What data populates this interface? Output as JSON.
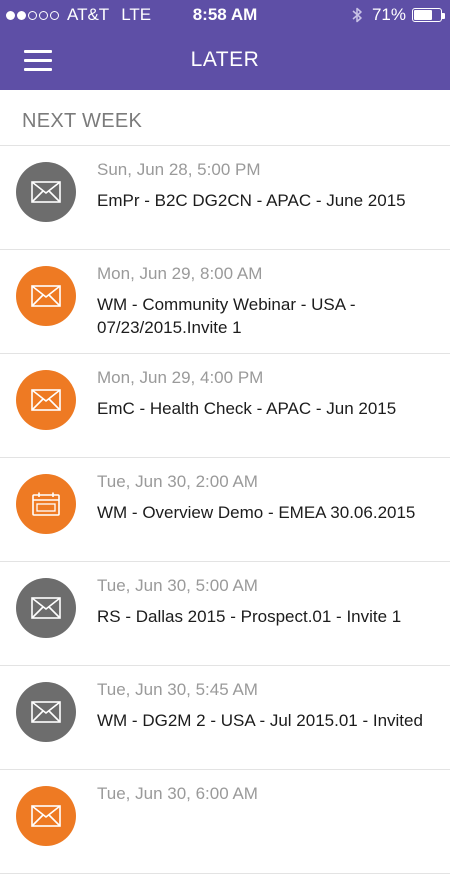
{
  "status_bar": {
    "carrier": "AT&T",
    "network": "LTE",
    "time": "8:58 AM",
    "battery": "71%",
    "battery_level": 0.71,
    "signal_bars": 2
  },
  "nav": {
    "title": "LATER"
  },
  "section": {
    "title": "NEXT WEEK"
  },
  "colors": {
    "header": "#5e4fa6",
    "orange": "#ee7a23",
    "gray": "#6d6d6d"
  },
  "items": [
    {
      "date": "Sun, Jun 28, 5:00 PM",
      "subject": "EmPr - B2C DG2CN - APAC - June 2015",
      "icon": "mail-icon",
      "color": "gray"
    },
    {
      "date": "Mon, Jun 29, 8:00 AM",
      "subject": "WM - Community Webinar - USA - 07/23/2015.Invite 1",
      "icon": "mail-icon",
      "color": "orange"
    },
    {
      "date": "Mon, Jun 29, 4:00 PM",
      "subject": "EmC - Health Check - APAC - Jun 2015",
      "icon": "mail-icon",
      "color": "orange"
    },
    {
      "date": "Tue, Jun 30, 2:00 AM",
      "subject": "WM - Overview Demo - EMEA 30.06.2015",
      "icon": "calendar-icon",
      "color": "orange"
    },
    {
      "date": "Tue, Jun 30, 5:00 AM",
      "subject": "RS - Dallas 2015 - Prospect.01 - Invite 1",
      "icon": "mail-icon",
      "color": "gray"
    },
    {
      "date": "Tue, Jun 30, 5:45 AM",
      "subject": "WM - DG2M 2 - USA - Jul 2015.01 - Invited",
      "icon": "mail-icon",
      "color": "gray"
    },
    {
      "date": "Tue, Jun 30, 6:00 AM",
      "subject": "",
      "icon": "mail-icon",
      "color": "orange"
    }
  ]
}
